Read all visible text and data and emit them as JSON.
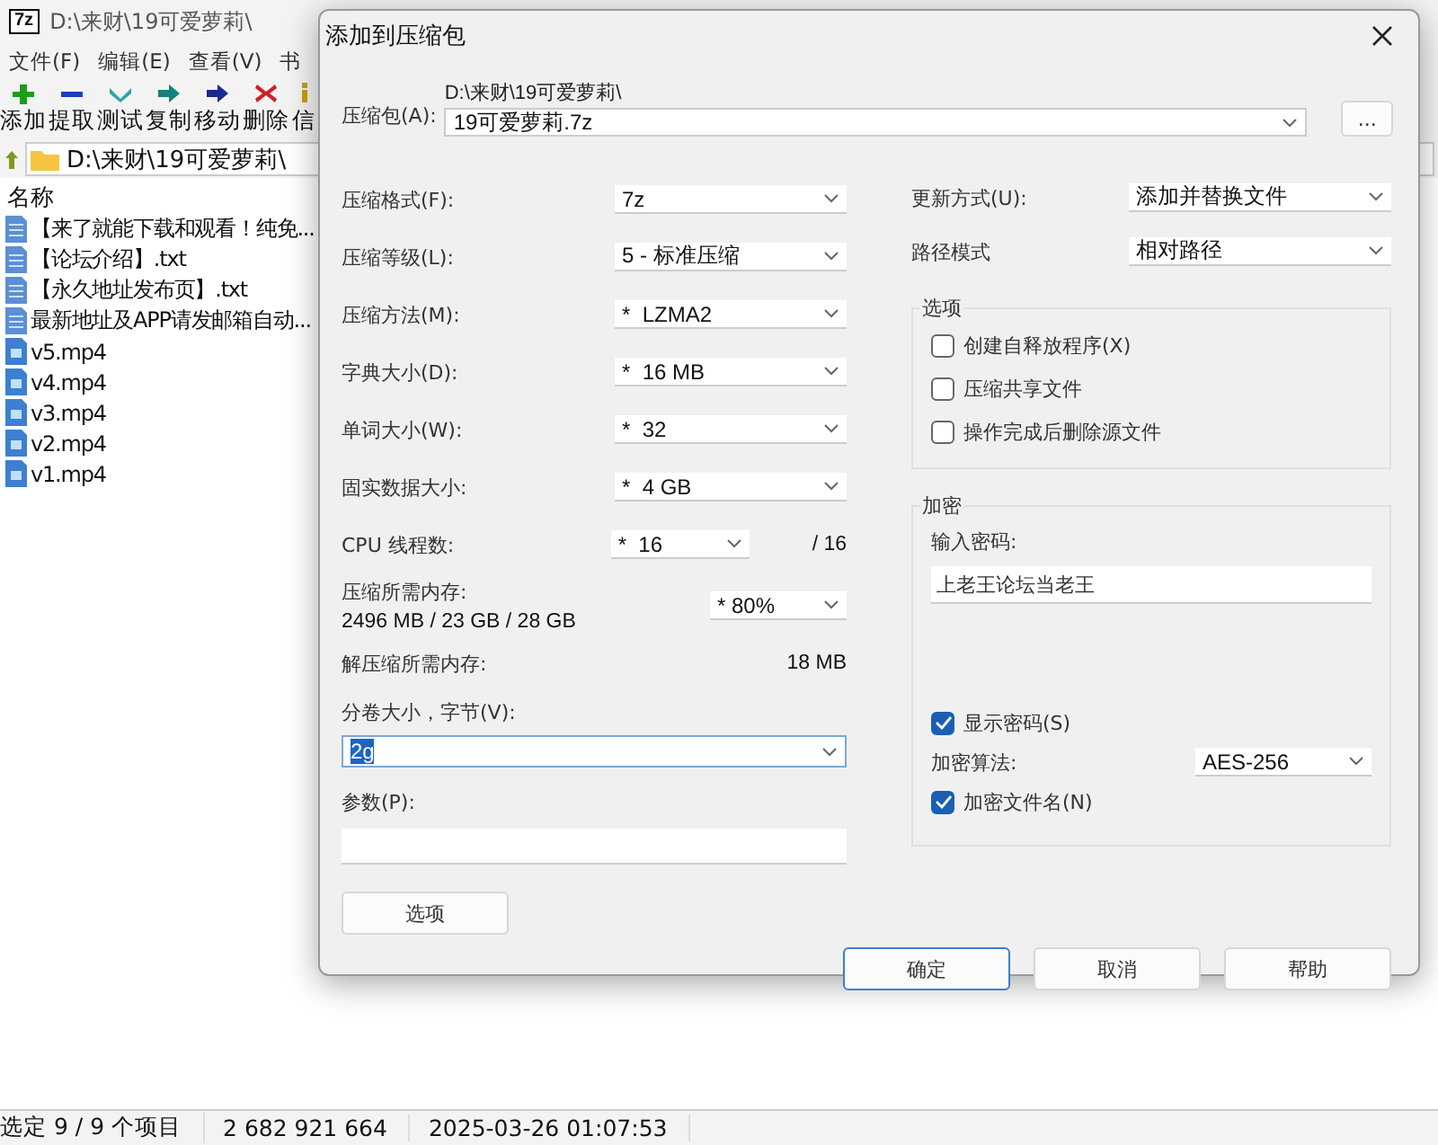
{
  "main_window": {
    "logo": "7z",
    "title": "D:\\来财\\19可爱萝莉\\",
    "menu": [
      "文件(F)",
      "编辑(E)",
      "查看(V)",
      "书"
    ],
    "toolbar": [
      "添加",
      "提取",
      "测试",
      "复制",
      "移动",
      "删除",
      "信"
    ],
    "path": "D:\\来财\\19可爱萝莉\\",
    "column": "名称",
    "files": [
      {
        "name": "【来了就能下载和观看！纯免...",
        "kind": "text"
      },
      {
        "name": "【论坛介绍】.txt",
        "kind": "text"
      },
      {
        "name": "【永久地址发布页】.txt",
        "kind": "text"
      },
      {
        "name": "最新地址及APP请发邮箱自动...",
        "kind": "text"
      },
      {
        "name": "v5.mp4",
        "kind": "video"
      },
      {
        "name": "v4.mp4",
        "kind": "video"
      },
      {
        "name": "v3.mp4",
        "kind": "video"
      },
      {
        "name": "v2.mp4",
        "kind": "video"
      },
      {
        "name": "v1.mp4",
        "kind": "video"
      }
    ],
    "status_bar": [
      "选定 9 / 9 个项目",
      "2 682 921 664",
      "2025-03-26 01:07:53"
    ]
  },
  "dialog": {
    "title": "添加到压缩包",
    "archive": {
      "label": "压缩包(A):",
      "folder": "D:\\来财\\19可爱萝莉\\",
      "value": "19可爱萝莉.7z",
      "browse": "..."
    },
    "left_rows": [
      {
        "kind": "select",
        "label": "压缩格式(F):",
        "value": "7z"
      },
      {
        "kind": "select",
        "label": "压缩等级(L):",
        "value": "5 - 标准压缩"
      },
      {
        "kind": "select",
        "label": "压缩方法(M):",
        "value": "*  LZMA2"
      },
      {
        "kind": "select",
        "label": "字典大小(D):",
        "value": "*  16 MB"
      },
      {
        "kind": "select",
        "label": "单词大小(W):",
        "value": "*  32"
      },
      {
        "kind": "select",
        "label": "固实数据大小:",
        "value": "*  4 GB"
      },
      {
        "kind": "threads",
        "label": "CPU 线程数:",
        "value": "*  16",
        "suffix": "/ 16"
      },
      {
        "kind": "memory",
        "label": "压缩所需内存:",
        "reading": "2496 MB / 23 GB / 28 GB",
        "value": "* 80%"
      },
      {
        "kind": "readonly",
        "label": "解压缩所需内存:",
        "reading": "18 MB"
      }
    ],
    "volume": {
      "label": "分卷大小，字节(V):",
      "value": "2g"
    },
    "params": {
      "label": "参数(P):"
    },
    "options_button": "选项",
    "update": {
      "label": "更新方式(U):",
      "value": "添加并替换文件"
    },
    "path_mode": {
      "label": "路径模式",
      "value": "相对路径"
    },
    "options_group": {
      "title": "选项",
      "checkboxes": [
        {
          "label": "创建自释放程序(X)",
          "checked": false
        },
        {
          "label": "压缩共享文件",
          "checked": false
        },
        {
          "label": "操作完成后删除源文件",
          "checked": false
        }
      ]
    },
    "encryption": {
      "title": "加密",
      "password_label": "输入密码:",
      "password": "上老王论坛当老王",
      "show_password": {
        "label": "显示密码(S)",
        "checked": true
      },
      "method_label": "加密算法:",
      "method": "AES-256",
      "encrypt_names": {
        "label": "加密文件名(N)",
        "checked": true
      }
    },
    "buttons": [
      {
        "label": "确定",
        "default": true
      },
      {
        "label": "取消",
        "default": false
      },
      {
        "label": "帮助",
        "default": false
      }
    ]
  }
}
